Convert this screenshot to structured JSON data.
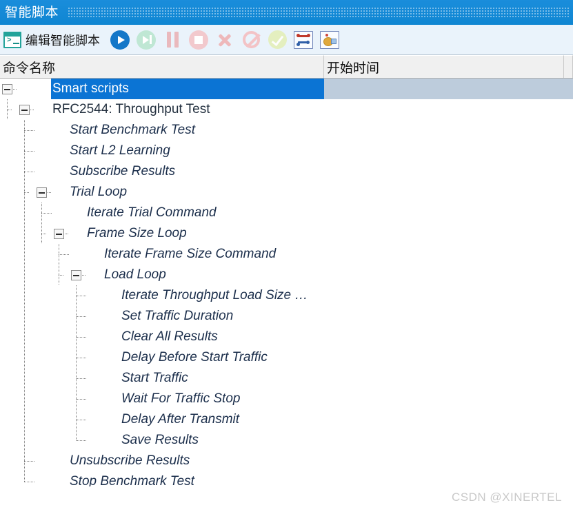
{
  "window": {
    "title": "智能脚本"
  },
  "toolbar": {
    "edit_script_label": "编辑智能脚本",
    "icons": [
      {
        "name": "console-icon",
        "label": "编辑智能脚本"
      },
      {
        "name": "run-icon",
        "label": "运行"
      },
      {
        "name": "step-run-icon",
        "label": "单步运行"
      },
      {
        "name": "pause-icon",
        "label": "暂停"
      },
      {
        "name": "stop-icon",
        "label": "停止"
      },
      {
        "name": "close-x-icon",
        "label": "关闭"
      },
      {
        "name": "forbidden-icon",
        "label": "禁用"
      },
      {
        "name": "check-icon",
        "label": "校验"
      },
      {
        "name": "topology-icon",
        "label": "拓扑"
      },
      {
        "name": "results-icon",
        "label": "结果"
      }
    ]
  },
  "columns": [
    {
      "label": "命令名称"
    },
    {
      "label": "开始时间"
    },
    {
      "label": ""
    }
  ],
  "colors": {
    "titlebar": "#1288d6",
    "toolbar": "#eaf3fb",
    "selection": "#0b74d4",
    "selection_secondary": "#bdccdc",
    "tree_text": "#1b2e4b"
  },
  "tree": [
    {
      "label": "Smart scripts",
      "depth": 0,
      "expander": "minus",
      "selected": true,
      "italic": false
    },
    {
      "label": "RFC2544: Throughput Test",
      "depth": 1,
      "expander": "minus",
      "selected": false,
      "italic": false
    },
    {
      "label": "Start Benchmark Test",
      "depth": 2,
      "expander": "none",
      "selected": false,
      "italic": true
    },
    {
      "label": "Start L2 Learning",
      "depth": 2,
      "expander": "none",
      "selected": false,
      "italic": true
    },
    {
      "label": "Subscribe Results",
      "depth": 2,
      "expander": "none",
      "selected": false,
      "italic": true
    },
    {
      "label": "Trial Loop",
      "depth": 2,
      "expander": "minus",
      "selected": false,
      "italic": true
    },
    {
      "label": "Iterate Trial Command",
      "depth": 3,
      "expander": "none",
      "selected": false,
      "italic": true
    },
    {
      "label": "Frame Size Loop",
      "depth": 3,
      "expander": "minus",
      "selected": false,
      "italic": true
    },
    {
      "label": "Iterate Frame Size Command",
      "depth": 4,
      "expander": "none",
      "selected": false,
      "italic": true
    },
    {
      "label": "Load Loop",
      "depth": 4,
      "expander": "minus",
      "selected": false,
      "italic": true
    },
    {
      "label": "Iterate Throughput Load Size …",
      "depth": 5,
      "expander": "none",
      "selected": false,
      "italic": true
    },
    {
      "label": "Set Traffic Duration",
      "depth": 5,
      "expander": "none",
      "selected": false,
      "italic": true
    },
    {
      "label": "Clear All Results",
      "depth": 5,
      "expander": "none",
      "selected": false,
      "italic": true
    },
    {
      "label": "Delay Before Start Traffic",
      "depth": 5,
      "expander": "none",
      "selected": false,
      "italic": true
    },
    {
      "label": "Start Traffic",
      "depth": 5,
      "expander": "none",
      "selected": false,
      "italic": true
    },
    {
      "label": "Wait For Traffic Stop",
      "depth": 5,
      "expander": "none",
      "selected": false,
      "italic": true
    },
    {
      "label": "Delay After Transmit",
      "depth": 5,
      "expander": "none",
      "selected": false,
      "italic": true
    },
    {
      "label": "Save Results",
      "depth": 5,
      "expander": "none",
      "selected": false,
      "italic": true,
      "last": true
    },
    {
      "label": "Unsubscribe Results",
      "depth": 2,
      "expander": "none",
      "selected": false,
      "italic": true
    },
    {
      "label": "Stop Benchmark Test",
      "depth": 2,
      "expander": "none",
      "selected": false,
      "italic": true,
      "last": true
    }
  ],
  "watermark": {
    "text": "CSDN @XINERTEL"
  }
}
